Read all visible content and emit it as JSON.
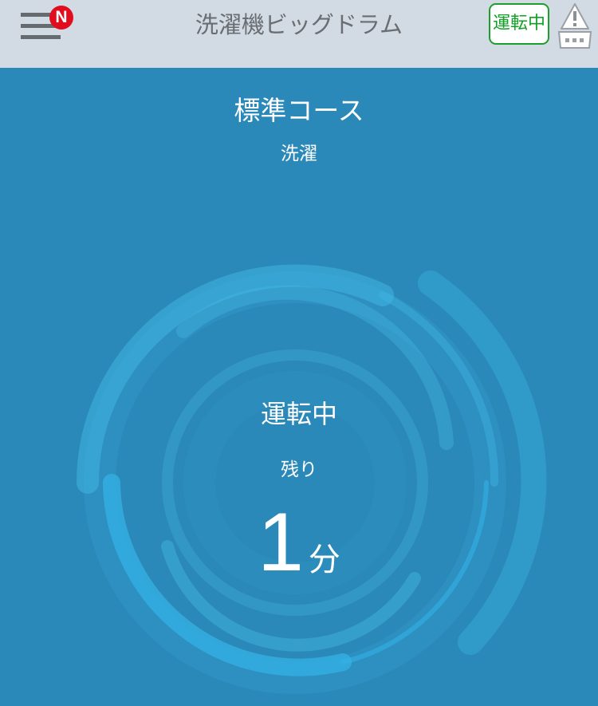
{
  "header": {
    "title": "洗濯機ビッグドラム",
    "menu_badge": "N",
    "status_pill": "運転中",
    "menu_icon": "hamburger-icon",
    "alert_icon": "warning-washer-icon"
  },
  "main": {
    "course_name": "標準コース",
    "phase": "洗濯",
    "operation_status": "運転中",
    "remaining_label": "残り",
    "remaining_value": "1",
    "remaining_unit": "分"
  },
  "colors": {
    "header_bg": "#d2dae3",
    "main_bg": "#2a89b8",
    "badge": "#e10d1e",
    "status_green": "#1e9e2e",
    "swirl": "#3ab0df"
  }
}
